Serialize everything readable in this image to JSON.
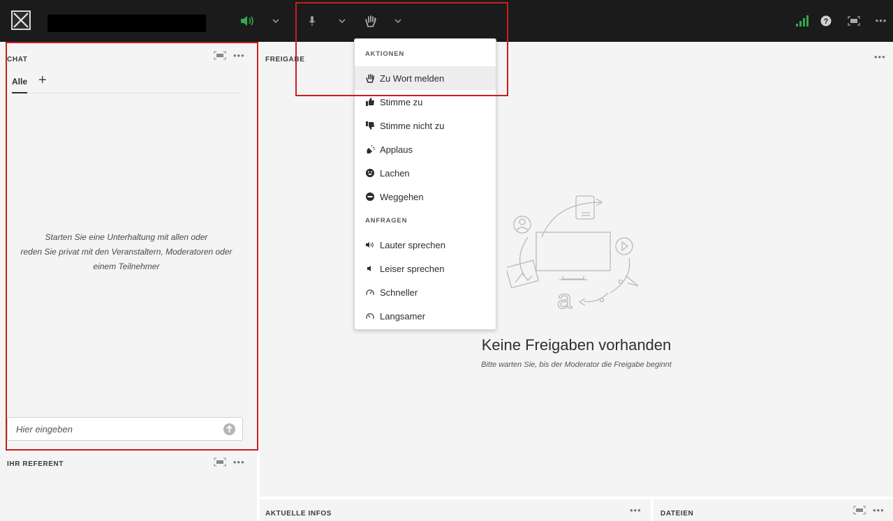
{
  "toolbar": {
    "icons": [
      "logo-icon",
      "speaker-icon",
      "chevron-down-icon",
      "microphone-icon",
      "raise-hand-icon",
      "signal-icon",
      "help-icon",
      "fullscreen-icon",
      "more-icon"
    ],
    "accent_green": "#33a852"
  },
  "chat": {
    "title": "CHAT",
    "tab_all": "Alle",
    "tab_add": "+",
    "empty_message_line1": "Starten Sie eine Unterhaltung mit allen oder",
    "empty_message_line2": "reden Sie privat mit den Veranstaltern, Moderatoren oder",
    "empty_message_line3": "einem Teilnehmer",
    "input_placeholder": "Hier eingeben"
  },
  "speaker_panel": {
    "title": "IHR REFERENT"
  },
  "share_panel": {
    "title": "FREIGABE",
    "empty_title": "Keine Freigaben vorhanden",
    "empty_subtitle": "Bitte warten Sie, bis der Moderator die Freigabe beginnt"
  },
  "info_panel": {
    "title": "AKTUELLE INFOS"
  },
  "files_panel": {
    "title": "DATEIEN"
  },
  "more_label": "•••",
  "dropdown": {
    "section_actions": "AKTIONEN",
    "actions": [
      {
        "label": "Zu Wort melden",
        "icon": "raise-hand-icon",
        "selected": true
      },
      {
        "label": "Stimme zu",
        "icon": "thumbs-up-icon"
      },
      {
        "label": "Stimme nicht zu",
        "icon": "thumbs-down-icon"
      },
      {
        "label": "Applaus",
        "icon": "applause-icon"
      },
      {
        "label": "Lachen",
        "icon": "laugh-icon"
      },
      {
        "label": "Weggehen",
        "icon": "step-away-icon"
      }
    ],
    "section_requests": "ANFRAGEN",
    "requests": [
      {
        "label": "Lauter sprechen",
        "icon": "volume-up-icon"
      },
      {
        "label": "Leiser sprechen",
        "icon": "volume-down-icon"
      },
      {
        "label": "Schneller",
        "icon": "faster-icon"
      },
      {
        "label": "Langsamer",
        "icon": "slower-icon"
      }
    ]
  },
  "highlight_color": "#c81e1e"
}
